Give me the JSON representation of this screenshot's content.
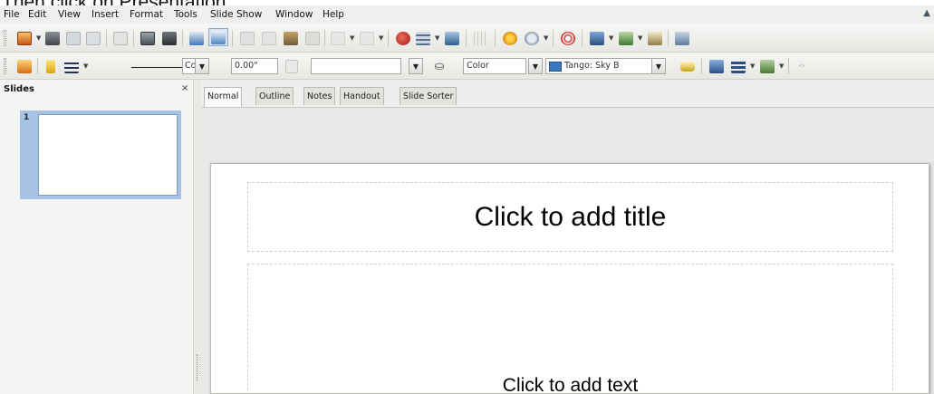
{
  "caption": "Then click on Presentation.",
  "menu": {
    "items": [
      {
        "label": "File",
        "u": "F",
        "rest": "ile"
      },
      {
        "label": "Edit",
        "u": "E",
        "rest": "dit"
      },
      {
        "label": "View",
        "u": "V",
        "rest": "iew"
      },
      {
        "label": "Insert",
        "u": "I",
        "rest": "nsert"
      },
      {
        "label": "Format",
        "u": "F",
        "rest": "o",
        "pre": "",
        "full": "Format"
      },
      {
        "label": "Tools",
        "u": "T",
        "rest": "ools"
      },
      {
        "label": "Slide Show",
        "u": "S",
        "rest": "lide Show"
      },
      {
        "label": "Window",
        "u": "W",
        "rest": "indow"
      },
      {
        "label": "Help",
        "u": "H",
        "rest": "elp"
      }
    ]
  },
  "toolbar2": {
    "line_style_value": "Co",
    "line_width_value": "0.00\"",
    "line_color_value": "",
    "area_style_value": "Color",
    "area_fill_value": "Tango: Sky B"
  },
  "slides_pane": {
    "title": "Slides",
    "close": "×",
    "slide_number": "1"
  },
  "tabs": [
    "Normal",
    "Outline",
    "Notes",
    "Handout",
    "Slide Sorter"
  ],
  "slide": {
    "title_placeholder": "Click to add title",
    "body_placeholder": "Click to add text"
  },
  "colors": {
    "area_fill_swatch": "#3a78c3",
    "thumbnail_highlight": "#a7c3e3"
  },
  "icons": [
    "new-icon",
    "templates-icon",
    "open-icon",
    "save-icon",
    "email-icon",
    "edit-file-icon",
    "export-pdf-icon",
    "print-icon",
    "spellcheck-icon",
    "autospellcheck-icon",
    "cut-icon",
    "copy-icon",
    "paste-icon",
    "clone-formatting-icon",
    "undo-icon",
    "redo-icon",
    "chart-icon",
    "table-icon",
    "image-icon",
    "grid-icon",
    "navigator-icon",
    "zoom-icon",
    "help-icon",
    "gallery-icon",
    "slide-design-icon",
    "slide-layout-icon"
  ]
}
